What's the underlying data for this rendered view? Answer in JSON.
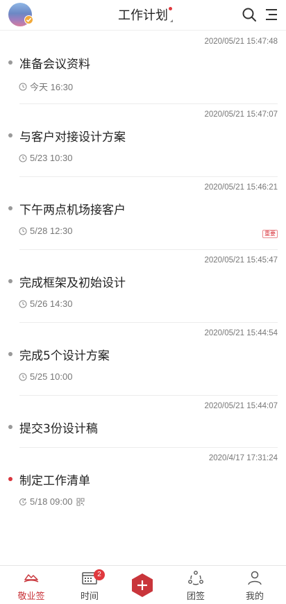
{
  "header": {
    "title": "工作计划"
  },
  "tasks": [
    {
      "timestamp": "2020/05/21 15:47:48",
      "name": "准备会议资料",
      "due": "今天 16:30"
    },
    {
      "timestamp": "2020/05/21 15:47:07",
      "name": "与客户对接设计方案",
      "due": "5/23 10:30"
    },
    {
      "timestamp": "2020/05/21 15:46:21",
      "name": "下午两点机场接客户",
      "due": "5/28 12:30",
      "tag": "重要"
    },
    {
      "timestamp": "2020/05/21 15:45:47",
      "name": "完成框架及初始设计",
      "due": "5/26 14:30"
    },
    {
      "timestamp": "2020/05/21 15:44:54",
      "name": "完成5个设计方案",
      "due": "5/25 10:00"
    },
    {
      "timestamp": "2020/05/21 15:44:07",
      "name": "提交3份设计稿"
    },
    {
      "timestamp": "2020/4/17 17:31:24",
      "name": "制定工作清单",
      "due": "5/18 09:00"
    }
  ],
  "tabbar": {
    "items": [
      {
        "label": "敬业签"
      },
      {
        "label": "时间",
        "badge": "2"
      },
      {
        "label": "团签"
      },
      {
        "label": "我的"
      }
    ]
  },
  "colors": {
    "accent": "#c9353b",
    "badge": "#e0393e"
  }
}
